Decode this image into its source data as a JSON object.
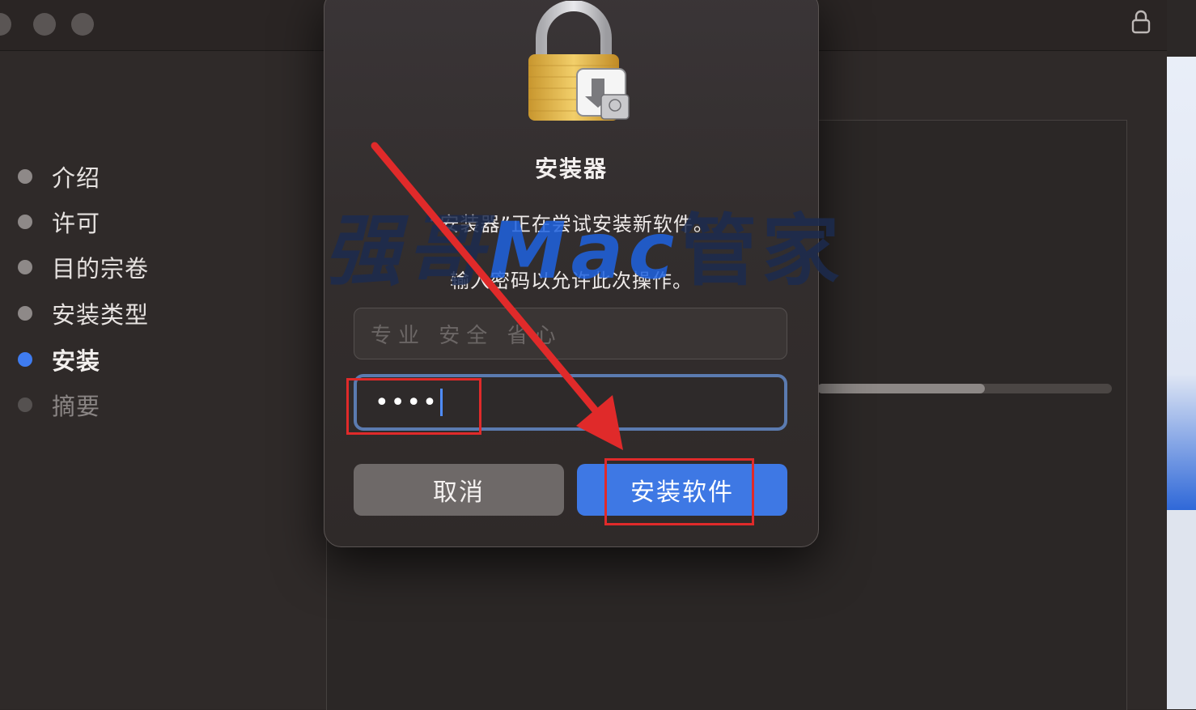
{
  "window": {
    "sidebar_steps": [
      {
        "label": "介绍",
        "state": "done"
      },
      {
        "label": "许可",
        "state": "done"
      },
      {
        "label": "目的宗卷",
        "state": "done"
      },
      {
        "label": "安装类型",
        "state": "done"
      },
      {
        "label": "安装",
        "state": "active"
      },
      {
        "label": "摘要",
        "state": "pending"
      }
    ],
    "progress": 0.57
  },
  "dialog": {
    "title": "安装器",
    "message_line1": "“安装器”正在尝试安装新软件。",
    "message_line2": "输入密码以允许此次操作。",
    "username_value": "专业  安全  省心",
    "password_mask": "••••",
    "cancel_label": "取消",
    "confirm_label": "安装软件"
  },
  "watermark": {
    "part1": "强哥",
    "part2": "Mac",
    "part3": "管家"
  },
  "colors": {
    "accent": "#3e78e4",
    "annotation": "#e02a2a"
  }
}
